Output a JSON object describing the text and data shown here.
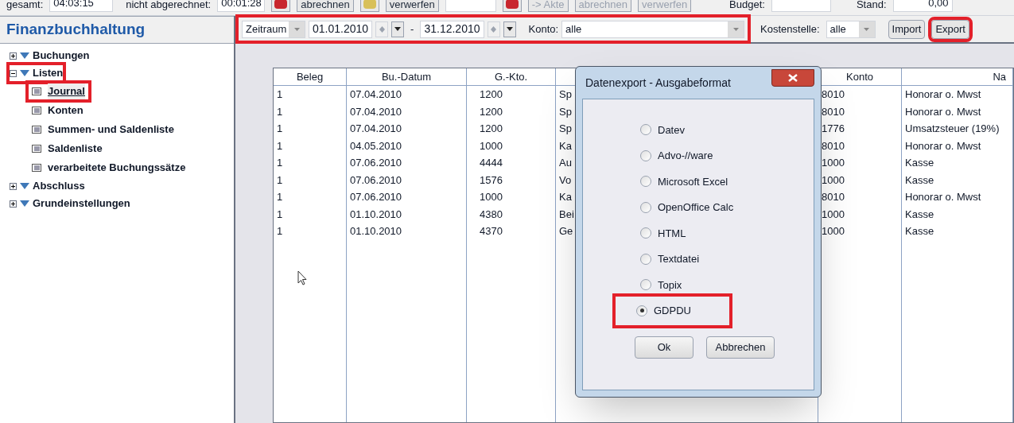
{
  "top_bar": {
    "total_label": "gesamt:",
    "total_value": "04:03:15",
    "unbilled_label": "nicht abgerechnet:",
    "unbilled_value": "00:01:28",
    "buttons": [
      {
        "kind": "stop"
      },
      {
        "kind": "text",
        "label": "abrechnen",
        "disabled": false
      },
      {
        "kind": "folder"
      },
      {
        "kind": "text",
        "label": "verwerfen",
        "disabled": false
      },
      {
        "kind": "field"
      },
      {
        "kind": "stop"
      },
      {
        "kind": "text",
        "label": "-> Akte",
        "disabled": true
      },
      {
        "kind": "text",
        "label": "abrechnen",
        "disabled": true
      },
      {
        "kind": "text",
        "label": "verwerfen",
        "disabled": true
      }
    ],
    "budget_label": "Budget:",
    "stand_label": "Stand:",
    "stand_value": "0,00"
  },
  "sidebar": {
    "title": "Finanzbuchhaltung",
    "items": [
      {
        "label": "Buchungen",
        "expanded": false,
        "highlighted": false
      },
      {
        "label": "Listen",
        "expanded": true,
        "highlighted": true,
        "children": [
          {
            "label": "Journal",
            "selected": true,
            "highlighted": true
          },
          {
            "label": "Konten",
            "selected": false,
            "highlighted": false
          },
          {
            "label": "Summen- und Saldenliste",
            "selected": false,
            "highlighted": false
          },
          {
            "label": "Saldenliste",
            "selected": false,
            "highlighted": false
          },
          {
            "label": "verarbeitete Buchungssätze",
            "selected": false,
            "highlighted": false
          }
        ]
      },
      {
        "label": "Abschluss",
        "expanded": false,
        "highlighted": false
      },
      {
        "label": "Grundeinstellungen",
        "expanded": false,
        "highlighted": false
      }
    ]
  },
  "filter_bar": {
    "highlighted": true,
    "period": "Zeitraum",
    "from": "01.01.2010",
    "separator": "-",
    "to": "31.12.2010",
    "account_label": "Konto:",
    "account": "alle"
  },
  "cost_center_label": "Kostenstelle:",
  "cost_center": "alle",
  "import_button": "Import",
  "export_button": {
    "label": "Export",
    "highlighted": true
  },
  "table": {
    "columns": [
      "Beleg",
      "Bu.-Datum",
      "G.-Kto.",
      "",
      "Konto",
      "Na"
    ],
    "rows": [
      [
        "1",
        "07.04.2010",
        "1200",
        "Sp",
        "8010",
        "Honorar o. Mwst"
      ],
      [
        "1",
        "07.04.2010",
        "1200",
        "Sp",
        "8010",
        "Honorar o. Mwst"
      ],
      [
        "1",
        "07.04.2010",
        "1200",
        "Sp",
        "1776",
        "Umsatzsteuer (19%)"
      ],
      [
        "1",
        "04.05.2010",
        "1000",
        "Ka",
        "8010",
        "Honorar o. Mwst"
      ],
      [
        "1",
        "07.06.2010",
        "4444",
        "Au",
        "1000",
        "Kasse"
      ],
      [
        "1",
        "07.06.2010",
        "1576",
        "Vo",
        "1000",
        "Kasse"
      ],
      [
        "1",
        "07.06.2010",
        "1000",
        "Ka",
        "8010",
        "Honorar o. Mwst"
      ],
      [
        "1",
        "01.10.2010",
        "4380",
        "Bei",
        "1000",
        "Kasse"
      ],
      [
        "1",
        "01.10.2010",
        "4370",
        "Ge",
        "1000",
        "Kasse"
      ]
    ]
  },
  "dialog": {
    "title": "Datenexport - Ausgabeformat",
    "options": [
      {
        "label": "Datev",
        "selected": false,
        "highlighted": false
      },
      {
        "label": "Advo-//ware",
        "selected": false,
        "highlighted": false
      },
      {
        "label": "Microsoft Excel",
        "selected": false,
        "highlighted": false
      },
      {
        "label": "OpenOffice Calc",
        "selected": false,
        "highlighted": false
      },
      {
        "label": "HTML",
        "selected": false,
        "highlighted": false
      },
      {
        "label": "Textdatei",
        "selected": false,
        "highlighted": false
      },
      {
        "label": "Topix",
        "selected": false,
        "highlighted": false
      },
      {
        "label": "GDPDU",
        "selected": true,
        "highlighted": true
      }
    ],
    "ok": "Ok",
    "cancel": "Abbrechen"
  }
}
